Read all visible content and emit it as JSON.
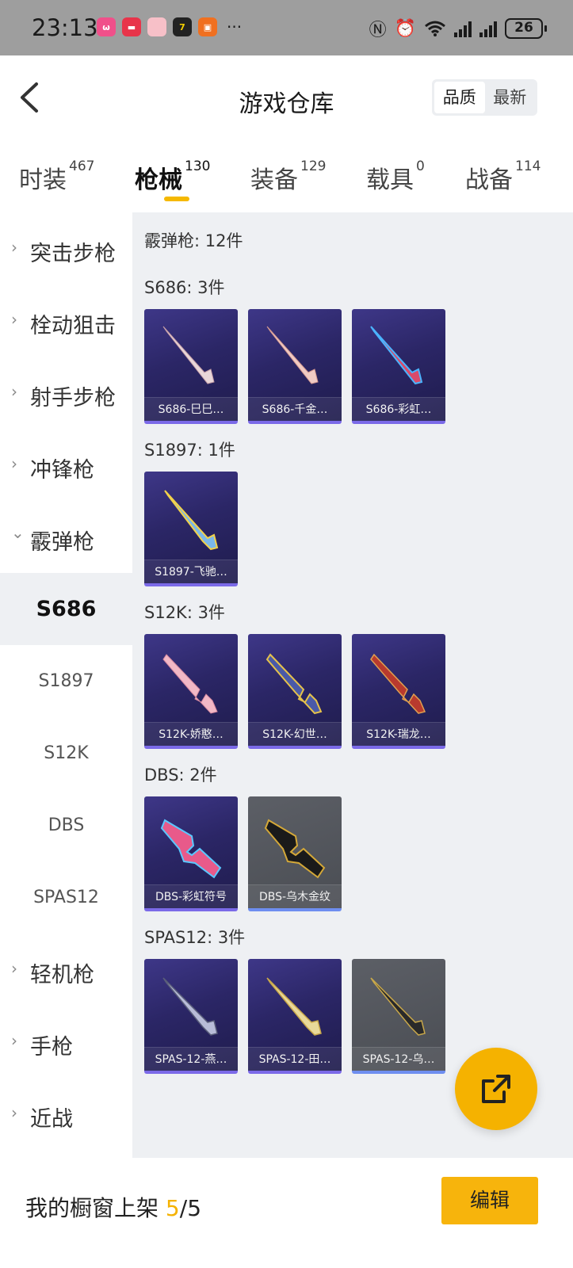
{
  "status_bar": {
    "time": "23:13",
    "battery": "26",
    "icons": [
      "nfc-icon",
      "alarm-icon",
      "wifi-icon",
      "signal-icon",
      "signal-icon",
      "battery-icon"
    ]
  },
  "header": {
    "title": "游戏仓库",
    "sort_options": [
      "品质",
      "最新"
    ],
    "active_sort": "品质"
  },
  "tabs": [
    {
      "label": "时装",
      "count": "467"
    },
    {
      "label": "枪械",
      "count": "130"
    },
    {
      "label": "装备",
      "count": "129"
    },
    {
      "label": "载具",
      "count": "0"
    },
    {
      "label": "战备",
      "count": "114"
    }
  ],
  "active_tab": "枪械",
  "sidebar": {
    "categories": [
      {
        "label": "突击步枪",
        "chevron": "›"
      },
      {
        "label": "栓动狙击",
        "chevron": "›"
      },
      {
        "label": "射手步枪",
        "chevron": "›"
      },
      {
        "label": "冲锋枪",
        "chevron": "›"
      },
      {
        "label": "霰弹枪",
        "chevron": "⌄"
      }
    ],
    "sub_items": [
      "S686",
      "S1897",
      "S12K",
      "DBS",
      "SPAS12"
    ],
    "active_sub": "S686",
    "categories_after": [
      {
        "label": "轻机枪",
        "chevron": "›"
      },
      {
        "label": "手枪",
        "chevron": "›"
      },
      {
        "label": "近战",
        "chevron": "›"
      }
    ]
  },
  "content": {
    "total": "霰弹枪: 12件",
    "sections": [
      {
        "title": "S686: 3件",
        "items": [
          {
            "name": "S686-巳巳…",
            "style": "purple"
          },
          {
            "name": "S686-千金…",
            "style": "purple"
          },
          {
            "name": "S686-彩虹…",
            "style": "purple"
          }
        ]
      },
      {
        "title": "S1897: 1件",
        "items": [
          {
            "name": "S1897-飞驰…",
            "style": "purple"
          }
        ]
      },
      {
        "title": "S12K: 3件",
        "items": [
          {
            "name": "S12K-娇憨…",
            "style": "purple"
          },
          {
            "name": "S12K-幻世…",
            "style": "purple"
          },
          {
            "name": "S12K-瑞龙…",
            "style": "purple"
          }
        ]
      },
      {
        "title": "DBS: 2件",
        "items": [
          {
            "name": "DBS-彩虹符号",
            "style": "purple"
          },
          {
            "name": "DBS-乌木金纹",
            "style": "gray"
          }
        ]
      },
      {
        "title": "SPAS12: 3件",
        "items": [
          {
            "name": "SPAS-12-燕…",
            "style": "purple"
          },
          {
            "name": "SPAS-12-田…",
            "style": "purple"
          },
          {
            "name": "SPAS-12-乌…",
            "style": "gray"
          }
        ]
      }
    ]
  },
  "bottom_bar": {
    "label": "我的橱窗上架",
    "current": "5",
    "separator": "/",
    "max": "5",
    "edit_label": "编辑"
  },
  "colors": {
    "accent": "#f5b200",
    "card_purple": "#2b2666",
    "card_gray": "#4a4d53"
  }
}
